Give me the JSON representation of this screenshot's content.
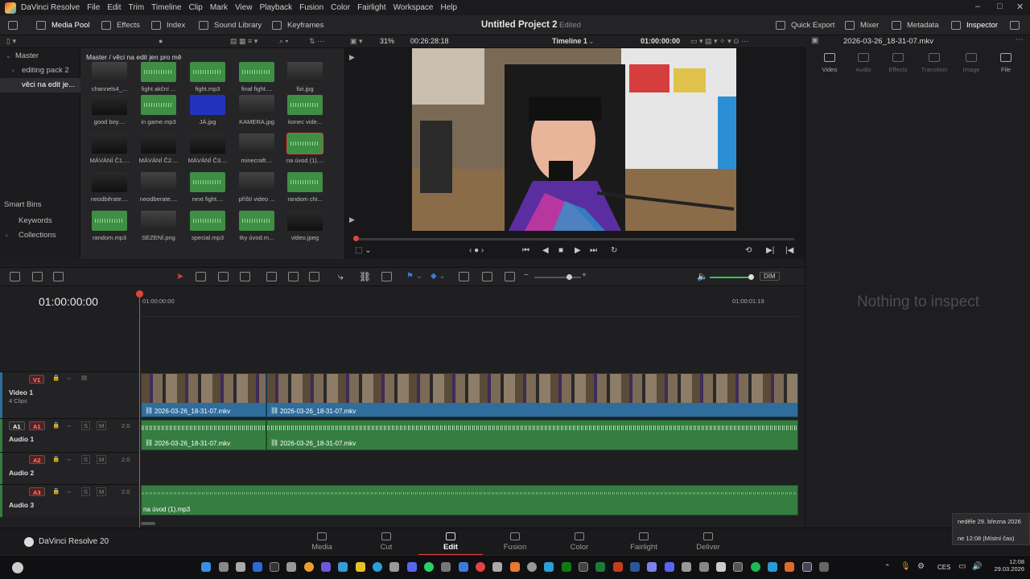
{
  "menubar": {
    "app_name": "DaVinci Resolve",
    "items": [
      "File",
      "Edit",
      "Trim",
      "Timeline",
      "Clip",
      "Mark",
      "View",
      "Playback",
      "Fusion",
      "Color",
      "Fairlight",
      "Workspace",
      "Help"
    ]
  },
  "toolbar": {
    "media_pool": "Media Pool",
    "effects": "Effects",
    "index": "Index",
    "sound_library": "Sound Library",
    "keyframes": "Keyframes",
    "project_title": "Untitled Project 2",
    "project_state": "Edited",
    "quick_export": "Quick Export",
    "mixer": "Mixer",
    "metadata": "Metadata",
    "inspector": "Inspector"
  },
  "viewer_bar": {
    "zoom": "31%",
    "source_timecode": "00:26:28:18",
    "timeline_name": "Timeline 1",
    "record_timecode": "01:00:00:00",
    "clip_name": "2026-03-26_18-31-07.mkv"
  },
  "bins": {
    "master": "Master",
    "items": [
      "editing pack 2",
      "věci na edit je..."
    ],
    "smart_bins": "Smart Bins",
    "smart_items": [
      "Keywords",
      "Collections"
    ]
  },
  "media_pool": {
    "path": "Master / věci na edit jen pro mě",
    "clips": [
      {
        "label": "channels4_...",
        "kind": "img"
      },
      {
        "label": "fight akční ...",
        "kind": "audio"
      },
      {
        "label": "fight.mp3",
        "kind": "audio"
      },
      {
        "label": "final fight....",
        "kind": "audio"
      },
      {
        "label": "fizi.jpg",
        "kind": "img"
      },
      {
        "label": "good boy....",
        "kind": "vid"
      },
      {
        "label": "in game.mp3",
        "kind": "audio"
      },
      {
        "label": "JÁ.jpg",
        "kind": "blue"
      },
      {
        "label": "KAMERA.jpg",
        "kind": "img"
      },
      {
        "label": "konec vide...",
        "kind": "audio"
      },
      {
        "label": "MÁVÁNÍ Č1....",
        "kind": "vid"
      },
      {
        "label": "MÁVÁNÍ Č2....",
        "kind": "vid"
      },
      {
        "label": "MÁVÁNÍ Č3....",
        "kind": "vid"
      },
      {
        "label": "minecraft....",
        "kind": "img"
      },
      {
        "label": "na úvod (1)....",
        "kind": "audio"
      },
      {
        "label": "neodběrate....",
        "kind": "vid"
      },
      {
        "label": "neodberate....",
        "kind": "img"
      },
      {
        "label": "next fight....",
        "kind": "audio"
      },
      {
        "label": "příští video ...",
        "kind": "img"
      },
      {
        "label": "random chi...",
        "kind": "audio"
      },
      {
        "label": "random.mp3",
        "kind": "audio"
      },
      {
        "label": "SEZENÍ.png",
        "kind": "img"
      },
      {
        "label": "special.mp3",
        "kind": "audio"
      },
      {
        "label": "tky úvod.m...",
        "kind": "audio"
      },
      {
        "label": "video.jpeg",
        "kind": "vid"
      }
    ]
  },
  "inspector": {
    "tabs": [
      "Video",
      "Audio",
      "Effects",
      "Transition",
      "Image",
      "File"
    ],
    "empty": "Nothing to inspect"
  },
  "timeline": {
    "timecode": "01:00:00:00",
    "ruler_start": "01:00:00:00",
    "ruler_end": "01:00:01:19",
    "tracks": {
      "v1": {
        "badge": "V1",
        "name": "Video 1",
        "sub": "4 Clips"
      },
      "a1": {
        "badge": "A1",
        "name": "Audio 1",
        "level": "2.0"
      },
      "a2": {
        "badge": "A2",
        "name": "Audio 2",
        "level": "2.0"
      },
      "a3": {
        "badge": "A3",
        "name": "Audio 3",
        "level": "2.0"
      }
    },
    "clip_a": "2026-03-26_18-31-07.mkv",
    "clip_b": "2026-03-26_18-31-07.mkv",
    "clip_a3": "na úvod (1).mp3",
    "dim": "DIM",
    "solo": "S",
    "mute": "M"
  },
  "pages": {
    "brand": "DaVinci Resolve 20",
    "tabs": [
      "Media",
      "Cut",
      "Edit",
      "Fusion",
      "Color",
      "Fairlight",
      "Deliver"
    ],
    "active": "Edit"
  },
  "tooltip": {
    "date_line": "neděle 29. března 2026",
    "time_line": "ne 12:08 (Místní čas)"
  },
  "taskbar": {
    "lang": "CES",
    "time": "12:08",
    "date": "29.03.2026"
  },
  "colors": {
    "accent": "#e0443c",
    "video_clip": "#2f6d9c",
    "audio_clip": "#357d40"
  }
}
